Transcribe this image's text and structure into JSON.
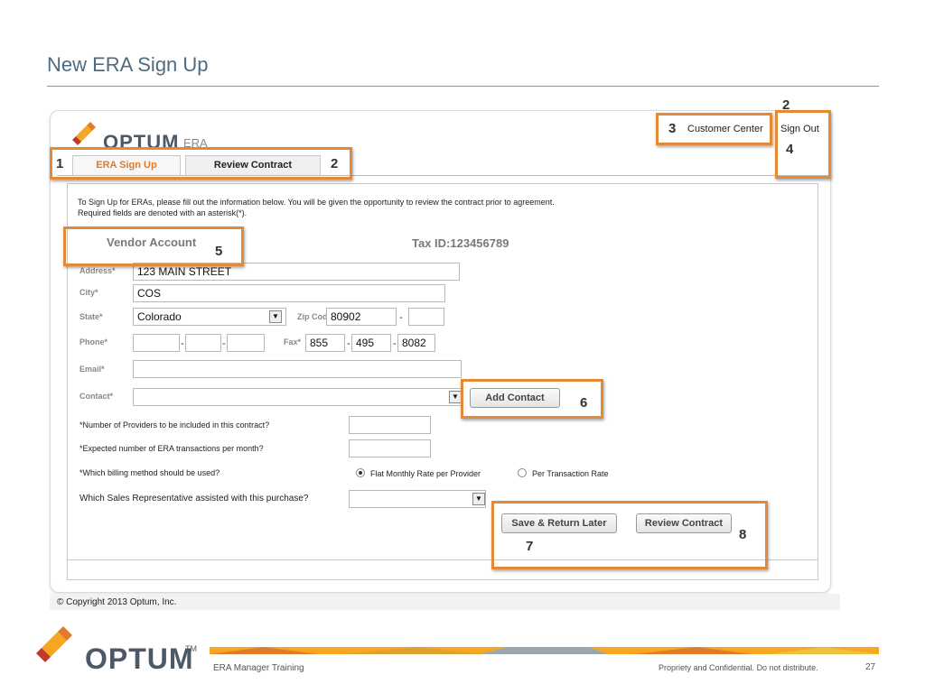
{
  "slide": {
    "title": "New ERA Sign Up",
    "footer_left": "ERA Manager Training",
    "footer_right": "Propriety and Confidential. Do not distribute.",
    "page_number": "27",
    "footer_logo": "OPTUM",
    "footer_tm": "TM"
  },
  "app": {
    "logo_text": "OPTUM",
    "logo_sub": "ERA Manager",
    "top_nav": {
      "customer_center": "Customer Center",
      "sign_out": "Sign Out"
    },
    "tabs": [
      {
        "label": "ERA Sign Up",
        "active": true
      },
      {
        "label": "Review Contract",
        "active": false
      }
    ],
    "intro_line1": "To Sign Up for ERAs, please fill out the information below. You will be given the opportunity to review the contract prior to agreement.",
    "intro_line2": "Required fields are denoted with an asterisk(*).",
    "vendor_account": "Vendor Account",
    "tax_id": "Tax ID:123456789",
    "form": {
      "address_label": "Address*",
      "address_value": "123 MAIN STREET",
      "city_label": "City*",
      "city_value": "COS",
      "state_label": "State*",
      "state_value": "Colorado",
      "zip_label": "Zip Code*",
      "zip_value": "80902",
      "zip_ext_value": "",
      "phone_label": "Phone*",
      "phone_1": "",
      "phone_2": "",
      "phone_3": "",
      "fax_label": "Fax*",
      "fax_1": "855",
      "fax_2": "495",
      "fax_3": "8082",
      "email_label": "Email*",
      "email_value": "",
      "contact_label": "Contact*",
      "contact_value": "",
      "add_contact": "Add Contact",
      "q_providers": "*Number of Providers to be included in this contract?",
      "q_transactions": "*Expected number of ERA transactions per month?",
      "q_billing": "*Which billing method should be used?",
      "billing_option_1": "Flat Monthly Rate per Provider",
      "billing_option_2": "Per Transaction Rate",
      "billing_selected": "Flat Monthly Rate per Provider",
      "q_sales_rep": "Which Sales Representative assisted with this purchase?",
      "sales_rep_value": "",
      "save_return": "Save & Return Later",
      "review_contract": "Review Contract"
    },
    "copyright": "© Copyright 2013 Optum, Inc."
  },
  "callouts": [
    "1",
    "2",
    "2",
    "3",
    "4",
    "5",
    "6",
    "7",
    "8"
  ],
  "colors": {
    "accent_orange": "#e58a34",
    "title_blue": "#4f6b7f",
    "logo_gray": "#4c5a67"
  }
}
